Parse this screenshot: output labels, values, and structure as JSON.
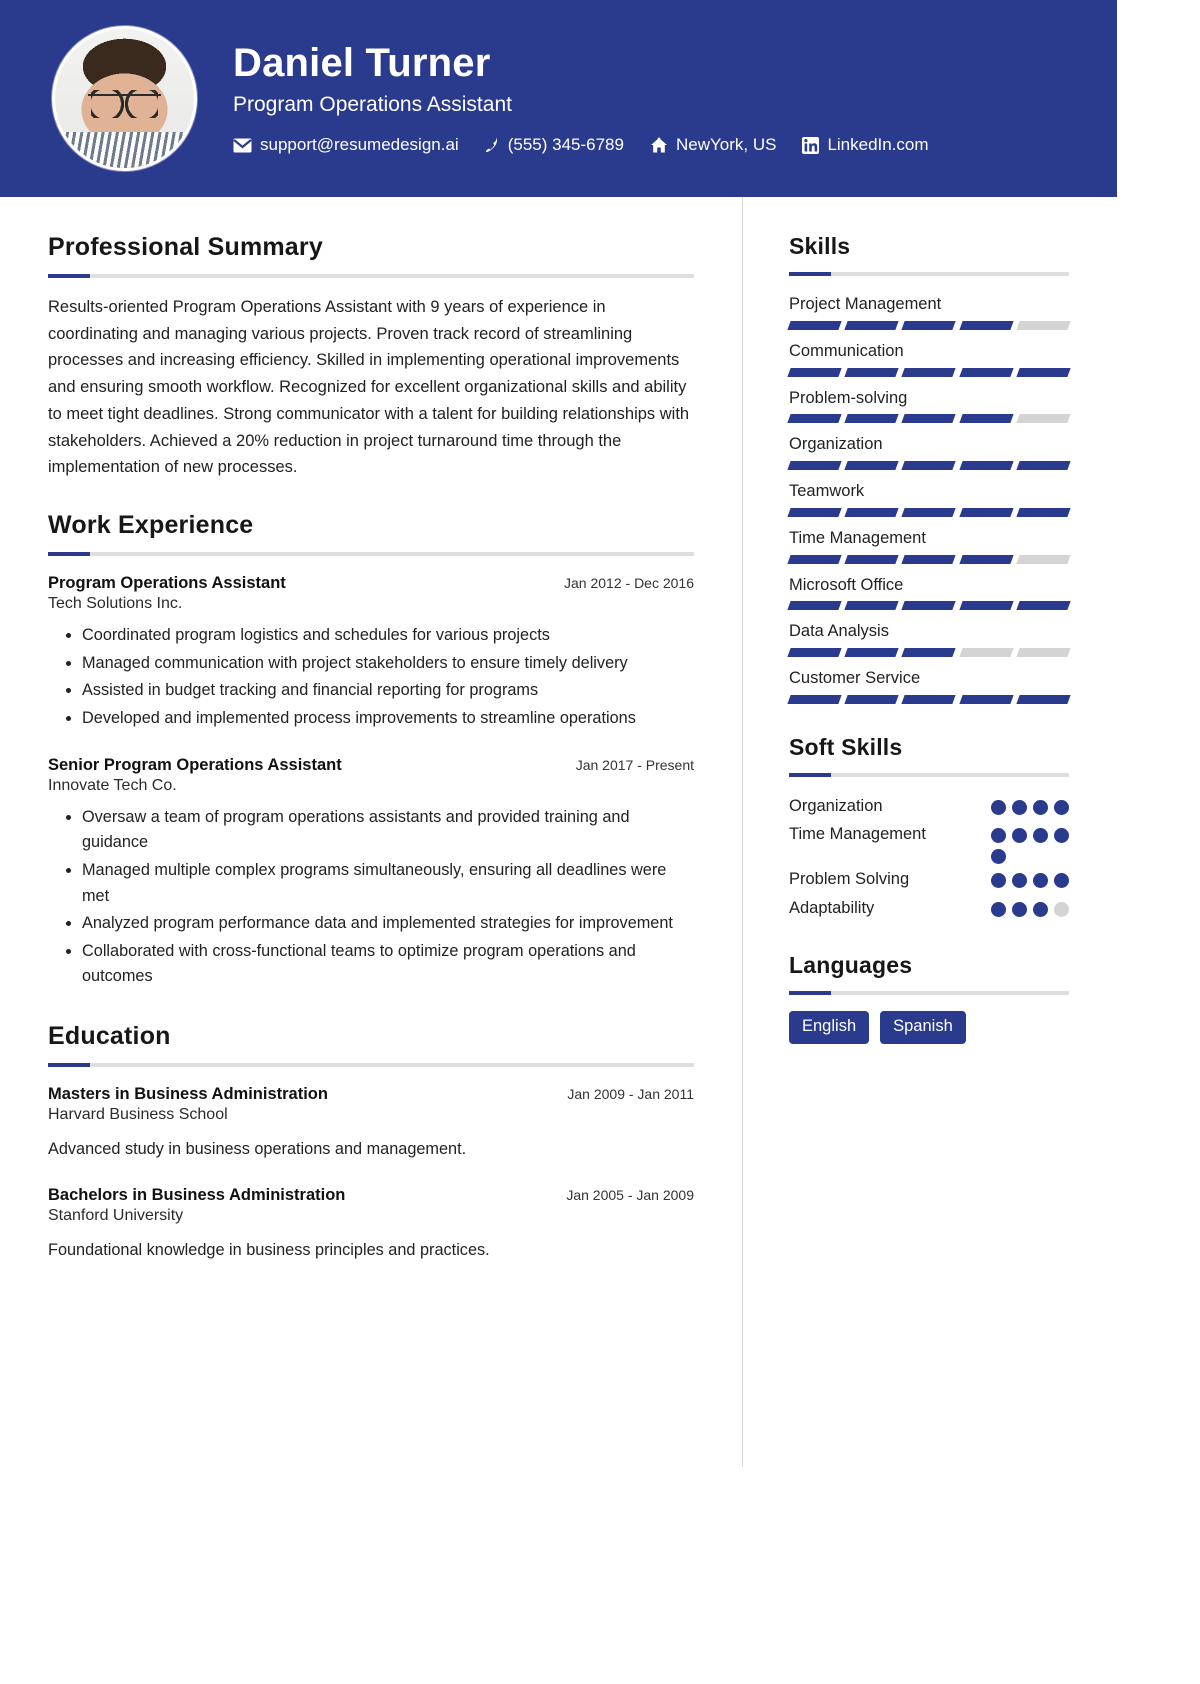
{
  "header": {
    "name": "Daniel Turner",
    "role": "Program Operations Assistant",
    "avatar_alt": "profile-photo",
    "contacts": [
      {
        "icon": "envelope-icon",
        "text": "support@resumedesign.ai"
      },
      {
        "icon": "phone-icon",
        "text": "(555) 345-6789"
      },
      {
        "icon": "home-icon",
        "text": "NewYork, US"
      },
      {
        "icon": "linkedin-icon",
        "text": "LinkedIn.com"
      }
    ],
    "background_color": "#2a3a8c"
  },
  "accent_color": "#2a3a8c",
  "muted_color": "#d4d4d4",
  "main": {
    "summary_heading": "Professional Summary",
    "summary_text": "Results-oriented Program Operations Assistant with 9 years of experience in coordinating and managing various projects. Proven track record of streamlining processes and increasing efficiency. Skilled in implementing operational improvements and ensuring smooth workflow. Recognized for excellent organizational skills and ability to meet tight deadlines. Strong communicator with a talent for building relationships with stakeholders. Achieved a 20% reduction in project turnaround time through the implementation of new processes.",
    "experience_heading": "Work Experience",
    "experience": [
      {
        "title": "Program Operations Assistant",
        "company": "Tech Solutions Inc.",
        "dates": "Jan 2012 - Dec 2016",
        "bullets": [
          "Coordinated program logistics and schedules for various projects",
          "Managed communication with project stakeholders to ensure timely delivery",
          "Assisted in budget tracking and financial reporting for programs",
          "Developed and implemented process improvements to streamline operations"
        ]
      },
      {
        "title": "Senior Program Operations Assistant",
        "company": "Innovate Tech Co.",
        "dates": "Jan 2017 - Present",
        "bullets": [
          "Oversaw a team of program operations assistants and provided training and guidance",
          "Managed multiple complex programs simultaneously, ensuring all deadlines were met",
          "Analyzed program performance data and implemented strategies for improvement",
          "Collaborated with cross-functional teams to optimize program operations and outcomes"
        ]
      }
    ],
    "education_heading": "Education",
    "education": [
      {
        "degree": "Masters in Business Administration",
        "school": "Harvard Business School",
        "dates": "Jan 2009 - Jan 2011",
        "description": "Advanced study in business operations and management."
      },
      {
        "degree": "Bachelors in Business Administration",
        "school": "Stanford University",
        "dates": "Jan 2005 - Jan 2009",
        "description": "Foundational knowledge in business principles and practices."
      }
    ]
  },
  "sidebar": {
    "skills_heading": "Skills",
    "skills_total_segments": 5,
    "skills": [
      {
        "name": "Project Management",
        "filled": 4
      },
      {
        "name": "Communication",
        "filled": 5
      },
      {
        "name": "Problem-solving",
        "filled": 4
      },
      {
        "name": "Organization",
        "filled": 5
      },
      {
        "name": "Teamwork",
        "filled": 5
      },
      {
        "name": "Time Management",
        "filled": 4
      },
      {
        "name": "Microsoft Office",
        "filled": 5
      },
      {
        "name": "Data Analysis",
        "filled": 3
      },
      {
        "name": "Customer Service",
        "filled": 5
      }
    ],
    "soft_skills_heading": "Soft Skills",
    "soft_skills_total_dots": 4,
    "soft_skills": [
      {
        "name": "Organization",
        "filled": 4
      },
      {
        "name": "Time Management",
        "filled": 5
      },
      {
        "name": "Problem Solving",
        "filled": 4
      },
      {
        "name": "Adaptability",
        "filled": 3
      }
    ],
    "languages_heading": "Languages",
    "languages": [
      "English",
      "Spanish"
    ]
  }
}
